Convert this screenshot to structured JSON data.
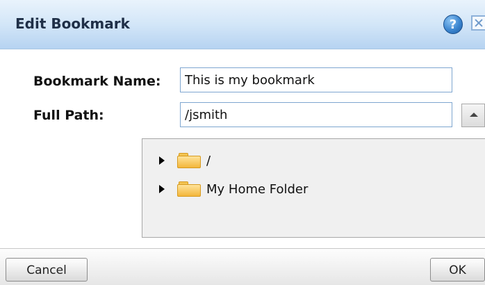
{
  "dialog": {
    "title": "Edit Bookmark",
    "help_icon_glyph": "?",
    "icons": {
      "help": "help-icon",
      "close": "close-icon"
    }
  },
  "form": {
    "name_label": "Bookmark Name:",
    "name_value": "This is my bookmark",
    "path_label": "Full Path:",
    "path_value": "/jsmith"
  },
  "tree": {
    "items": [
      {
        "label": "/",
        "icon": "folder-icon"
      },
      {
        "label": "My Home Folder",
        "icon": "folder-icon"
      }
    ]
  },
  "footer": {
    "cancel_label": "Cancel",
    "ok_label": "OK"
  }
}
